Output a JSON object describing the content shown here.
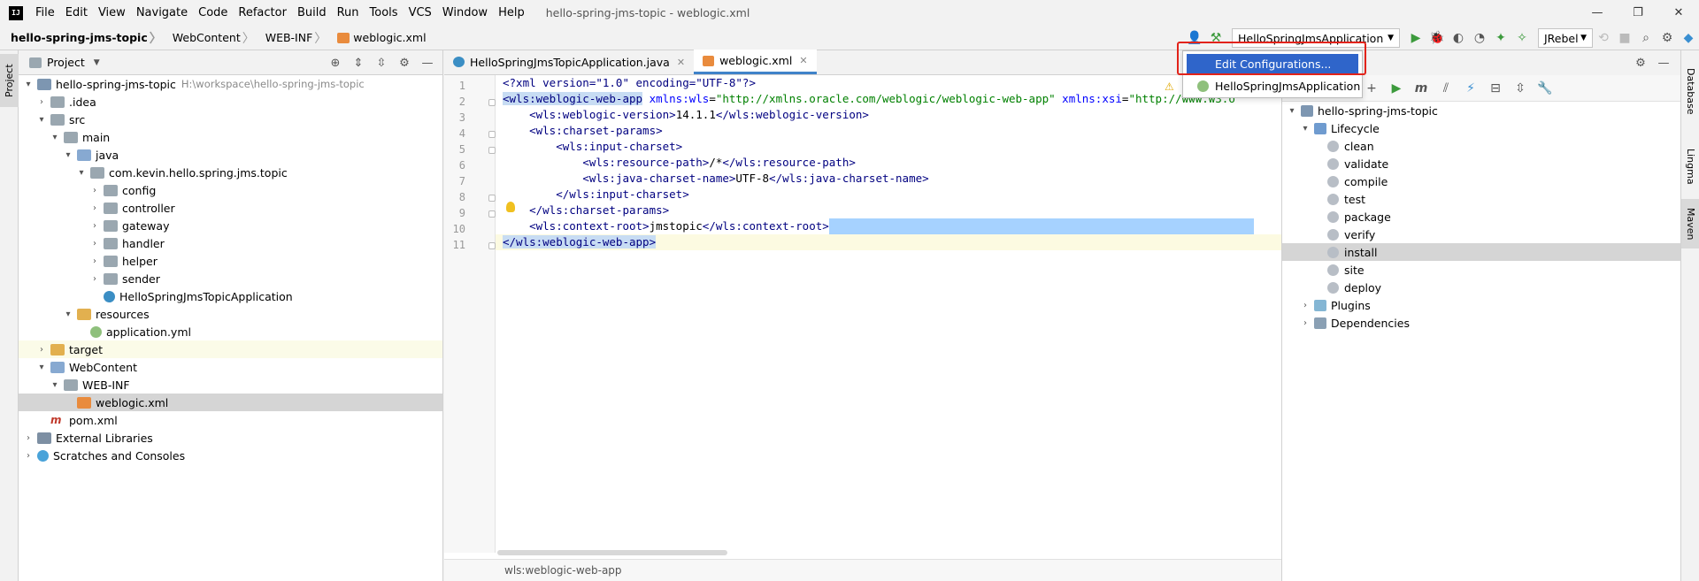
{
  "menubar": {
    "logo": "IJ",
    "items": [
      "File",
      "Edit",
      "View",
      "Navigate",
      "Code",
      "Refactor",
      "Build",
      "Run",
      "Tools",
      "VCS",
      "Window",
      "Help"
    ],
    "window_title": "hello-spring-jms-topic - weblogic.xml",
    "controls": [
      "—",
      "❐",
      "✕"
    ]
  },
  "breadcrumb": [
    "hello-spring-jms-topic",
    "WebContent",
    "WEB-INF",
    "weblogic.xml"
  ],
  "toolbar": {
    "run_config": "HelloSpringJmsApplication",
    "jrebel": "JRebel"
  },
  "dropdown": {
    "items": [
      "Edit Configurations...",
      "HelloSpringJmsApplication"
    ]
  },
  "left_strip": {
    "tab": "Project"
  },
  "project": {
    "title": "Project",
    "tree": [
      {
        "label": "hello-spring-jms-topic",
        "hint": "H:\\workspace\\hello-spring-jms-topic",
        "depth": 0,
        "arrow": "▾",
        "icon": "module"
      },
      {
        "label": ".idea",
        "depth": 1,
        "arrow": "›",
        "icon": "folder"
      },
      {
        "label": "src",
        "depth": 1,
        "arrow": "▾",
        "icon": "folder"
      },
      {
        "label": "main",
        "depth": 2,
        "arrow": "▾",
        "icon": "folder"
      },
      {
        "label": "java",
        "depth": 3,
        "arrow": "▾",
        "icon": "folder-blue"
      },
      {
        "label": "com.kevin.hello.spring.jms.topic",
        "depth": 4,
        "arrow": "▾",
        "icon": "folder"
      },
      {
        "label": "config",
        "depth": 5,
        "arrow": "›",
        "icon": "folder"
      },
      {
        "label": "controller",
        "depth": 5,
        "arrow": "›",
        "icon": "folder"
      },
      {
        "label": "gateway",
        "depth": 5,
        "arrow": "›",
        "icon": "folder"
      },
      {
        "label": "handler",
        "depth": 5,
        "arrow": "›",
        "icon": "folder"
      },
      {
        "label": "helper",
        "depth": 5,
        "arrow": "›",
        "icon": "folder"
      },
      {
        "label": "sender",
        "depth": 5,
        "arrow": "›",
        "icon": "folder"
      },
      {
        "label": "HelloSpringJmsTopicApplication",
        "depth": 5,
        "arrow": "",
        "icon": "java"
      },
      {
        "label": "resources",
        "depth": 3,
        "arrow": "▾",
        "icon": "folder-orange"
      },
      {
        "label": "application.yml",
        "depth": 4,
        "arrow": "",
        "icon": "yml"
      },
      {
        "label": "target",
        "depth": 1,
        "arrow": "›",
        "icon": "folder-orange"
      },
      {
        "label": "WebContent",
        "depth": 1,
        "arrow": "▾",
        "icon": "folder-blue"
      },
      {
        "label": "WEB-INF",
        "depth": 2,
        "arrow": "▾",
        "icon": "folder"
      },
      {
        "label": "weblogic.xml",
        "depth": 3,
        "arrow": "",
        "icon": "xml"
      },
      {
        "label": "pom.xml",
        "depth": 1,
        "arrow": "",
        "icon": "maven"
      },
      {
        "label": "External Libraries",
        "depth": 0,
        "arrow": "›",
        "icon": "lib"
      },
      {
        "label": "Scratches and Consoles",
        "depth": 0,
        "arrow": "›",
        "icon": "scratch"
      }
    ]
  },
  "editor": {
    "tabs": [
      {
        "label": "HelloSpringJmsTopicApplication.java",
        "icon": "java",
        "close": "✕"
      },
      {
        "label": "weblogic.xml",
        "icon": "xml",
        "close": "✕"
      }
    ],
    "line_numbers": [
      "1",
      "2",
      "3",
      "4",
      "5",
      "6",
      "7",
      "8",
      "9",
      "10",
      "11"
    ],
    "lines": [
      {
        "parts": [
          [
            "pi",
            "<?xml version=\"1.0\" encoding=\"UTF-8\"?>"
          ]
        ]
      },
      {
        "parts": [
          [
            "tagh",
            "<wls:weblogic-web-app"
          ],
          [
            "attr",
            " xmlns:wls"
          ],
          [
            "text",
            "="
          ],
          [
            "val",
            "\"http://xmlns.oracle.com/weblogic/weblogic-web-app\""
          ],
          [
            "attr",
            " xmlns:xsi"
          ],
          [
            "text",
            "="
          ],
          [
            "val",
            "\"http://www.w3.o"
          ]
        ]
      },
      {
        "parts": [
          [
            "text",
            "    "
          ],
          [
            "tag",
            "<wls:weblogic-version>"
          ],
          [
            "text",
            "14.1.1"
          ],
          [
            "tag",
            "</wls:weblogic-version>"
          ]
        ]
      },
      {
        "parts": [
          [
            "text",
            "    "
          ],
          [
            "tag",
            "<wls:charset-params>"
          ]
        ]
      },
      {
        "parts": [
          [
            "text",
            "        "
          ],
          [
            "tag",
            "<wls:input-charset>"
          ]
        ]
      },
      {
        "parts": [
          [
            "text",
            "            "
          ],
          [
            "tag",
            "<wls:resource-path>"
          ],
          [
            "text",
            "/*"
          ],
          [
            "tag",
            "</wls:resource-path>"
          ]
        ]
      },
      {
        "parts": [
          [
            "text",
            "            "
          ],
          [
            "tag",
            "<wls:java-charset-name>"
          ],
          [
            "text",
            "UTF-8"
          ],
          [
            "tag",
            "</wls:java-charset-name>"
          ]
        ]
      },
      {
        "parts": [
          [
            "text",
            "        "
          ],
          [
            "tag",
            "</wls:input-charset>"
          ]
        ]
      },
      {
        "parts": [
          [
            "text",
            "    "
          ],
          [
            "tag",
            "</wls:charset-params>"
          ]
        ]
      },
      {
        "parts": [
          [
            "text",
            "    "
          ],
          [
            "tag",
            "<wls:context-root>"
          ],
          [
            "text",
            "jmstopic"
          ],
          [
            "tag",
            "</wls:context-root>"
          ]
        ]
      },
      {
        "parts": [
          [
            "tagh",
            "</wls:weblogic-web-app>"
          ]
        ]
      }
    ],
    "footer_breadcrumb": "wls:weblogic-web-app"
  },
  "maven": {
    "tree": [
      {
        "label": "hello-spring-jms-topic",
        "depth": 0,
        "arrow": "▾",
        "icon": "m"
      },
      {
        "label": "Lifecycle",
        "depth": 1,
        "arrow": "▾",
        "icon": "life"
      },
      {
        "label": "clean",
        "depth": 2,
        "arrow": "",
        "icon": "gear"
      },
      {
        "label": "validate",
        "depth": 2,
        "arrow": "",
        "icon": "gear"
      },
      {
        "label": "compile",
        "depth": 2,
        "arrow": "",
        "icon": "gear"
      },
      {
        "label": "test",
        "depth": 2,
        "arrow": "",
        "icon": "gear"
      },
      {
        "label": "package",
        "depth": 2,
        "arrow": "",
        "icon": "gear"
      },
      {
        "label": "verify",
        "depth": 2,
        "arrow": "",
        "icon": "gear"
      },
      {
        "label": "install",
        "depth": 2,
        "arrow": "",
        "icon": "gear",
        "selected": true
      },
      {
        "label": "site",
        "depth": 2,
        "arrow": "",
        "icon": "gear"
      },
      {
        "label": "deploy",
        "depth": 2,
        "arrow": "",
        "icon": "gear"
      },
      {
        "label": "Plugins",
        "depth": 1,
        "arrow": "›",
        "icon": "plug"
      },
      {
        "label": "Dependencies",
        "depth": 1,
        "arrow": "›",
        "icon": "dep"
      }
    ]
  },
  "right_strip": {
    "tabs": [
      "Database",
      "Lingma",
      "Maven"
    ]
  },
  "colors": {
    "accent": "#2f65ca",
    "highlight_box": "#e2231a",
    "selection": "#a6d2ff"
  }
}
